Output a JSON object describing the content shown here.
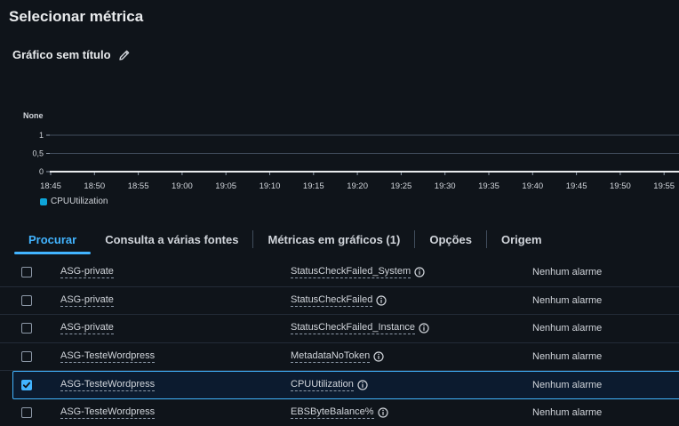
{
  "page": {
    "title": "Selecionar métrica"
  },
  "graph": {
    "title": "Gráfico sem título",
    "edit_icon": "pencil-icon"
  },
  "chart_data": {
    "type": "line",
    "ylabel": "None",
    "ytick_labels": [
      "0",
      "0,5",
      "1"
    ],
    "ylim": [
      0,
      1
    ],
    "x": [
      "18:45",
      "18:50",
      "18:55",
      "19:00",
      "19:05",
      "19:10",
      "19:15",
      "19:20",
      "19:25",
      "19:30",
      "19:35",
      "19:40",
      "19:45",
      "19:50",
      "19:55"
    ],
    "series": [
      {
        "name": "CPUUtilization",
        "color": "#0ea5d9",
        "values": [
          0,
          0,
          0,
          0,
          0,
          0,
          0,
          0,
          0,
          0,
          0,
          0,
          0,
          0,
          0
        ]
      }
    ],
    "grid": true
  },
  "tabs": [
    {
      "label": "Procurar",
      "active": true
    },
    {
      "label": "Consulta a várias fontes",
      "active": false
    },
    {
      "label": "Métricas em gráficos (1)",
      "active": false
    },
    {
      "label": "Opções",
      "active": false
    },
    {
      "label": "Origem",
      "active": false
    }
  ],
  "rows": [
    {
      "asg": "ASG-private",
      "metric": "StatusCheckFailed_System",
      "alarm": "Nenhum alarme",
      "checked": false
    },
    {
      "asg": "ASG-private",
      "metric": "StatusCheckFailed",
      "alarm": "Nenhum alarme",
      "checked": false
    },
    {
      "asg": "ASG-private",
      "metric": "StatusCheckFailed_Instance",
      "alarm": "Nenhum alarme",
      "checked": false
    },
    {
      "asg": "ASG-TesteWordpress",
      "metric": "MetadataNoToken",
      "alarm": "Nenhum alarme",
      "checked": false
    },
    {
      "asg": "ASG-TesteWordpress",
      "metric": "CPUUtilization",
      "alarm": "Nenhum alarme",
      "checked": true
    },
    {
      "asg": "ASG-TesteWordpress",
      "metric": "EBSByteBalance%",
      "alarm": "Nenhum alarme",
      "checked": false
    }
  ],
  "colors": {
    "accent": "#42b4ff",
    "background": "#0f141a",
    "series": "#0ea5d9"
  }
}
